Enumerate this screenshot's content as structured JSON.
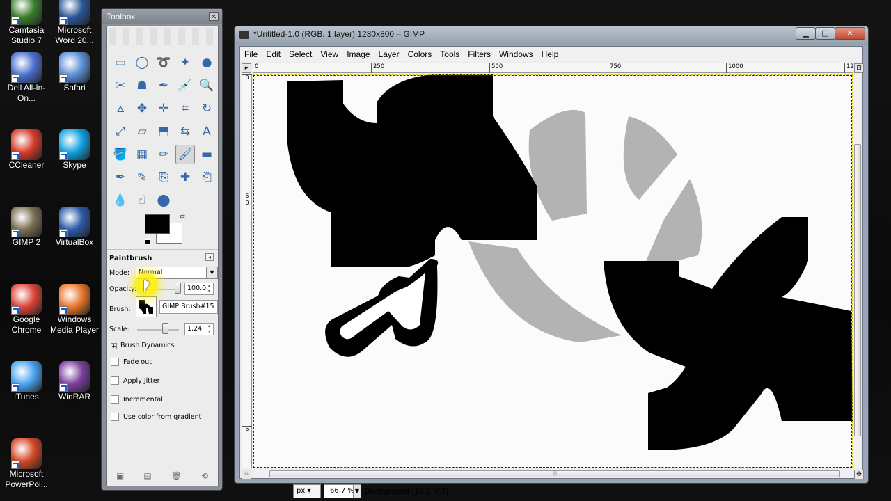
{
  "desktop": {
    "icons": [
      {
        "label": "Camtasia Studio 7",
        "icon": "camtasia-icon",
        "color": "#3a7d2c"
      },
      {
        "label": "Microsoft Word 20...",
        "icon": "word-icon",
        "color": "#2b5797"
      },
      {
        "label": "Dell All-In-On...",
        "icon": "dell-icon",
        "color": "#4a6fd0"
      },
      {
        "label": "Safari",
        "icon": "safari-icon",
        "color": "#5b8fd6"
      },
      {
        "label": "CCleaner",
        "icon": "ccleaner-icon",
        "color": "#d43a2a"
      },
      {
        "label": "Skype",
        "icon": "skype-icon",
        "color": "#10a2e0"
      },
      {
        "label": "GIMP 2",
        "icon": "gimp-icon",
        "color": "#7a6d55"
      },
      {
        "label": "VirtualBox",
        "icon": "virtualbox-icon",
        "color": "#2a5aa8"
      },
      {
        "label": "Google Chrome",
        "icon": "chrome-icon",
        "color": "#db4437"
      },
      {
        "label": "Windows Media Player",
        "icon": "media-player-icon",
        "color": "#e8762c"
      },
      {
        "label": "iTunes",
        "icon": "itunes-icon",
        "color": "#4aa3f0"
      },
      {
        "label": "WinRAR",
        "icon": "winrar-icon",
        "color": "#7b3f9e"
      },
      {
        "label": "Microsoft PowerPoi...",
        "icon": "powerpoint-icon",
        "color": "#d24726"
      }
    ]
  },
  "toolbox": {
    "title": "Toolbox",
    "close": "×",
    "tools": [
      "rect-select-icon",
      "ellipse-select-icon",
      "free-select-icon",
      "fuzzy-select-icon",
      "color-select-icon",
      "scissors-icon",
      "foreground-select-icon",
      "paths-icon",
      "color-picker-icon",
      "zoom-icon",
      "measure-icon",
      "move-icon",
      "align-icon",
      "crop-icon",
      "rotate-icon",
      "scale-icon",
      "shear-icon",
      "perspective-icon",
      "flip-icon",
      "text-icon",
      "bucket-fill-icon",
      "blend-icon",
      "pencil-icon",
      "paintbrush-icon",
      "eraser-icon",
      "airbrush-icon",
      "ink-icon",
      "clone-icon",
      "heal-icon",
      "perspective-clone-icon",
      "blur-icon",
      "smudge-icon",
      "dodge-burn-icon"
    ],
    "tool_glyphs": [
      "▭",
      "◯",
      "➰",
      "✦",
      "●",
      "✂",
      "☗",
      "✒",
      "💉",
      "🔍",
      "⩟",
      "✥",
      "✛",
      "⌗",
      "↻",
      "⤢",
      "▱",
      "⬒",
      "⇆",
      "A",
      "🪣",
      "▦",
      "✏",
      "🖌",
      "▬",
      "✒",
      "✎",
      "⎘",
      "✚",
      "⎗",
      "💧",
      "☝",
      "⬤"
    ],
    "selected_tool": "paintbrush-icon",
    "options": {
      "title": "Paintbrush",
      "mode_label": "Mode:",
      "mode_value": "Normal",
      "opacity_label": "Opacity:",
      "opacity_value": "100.0",
      "brush_label": "Brush:",
      "brush_name": "GIMP Brush#15",
      "scale_label": "Scale:",
      "scale_value": "1.24",
      "brush_dynamics": "Brush Dynamics",
      "checkboxes": [
        "Fade out",
        "Apply Jitter",
        "Incremental",
        "Use color from gradient"
      ]
    },
    "colors": {
      "foreground": "#000000",
      "background": "#ffffff"
    }
  },
  "image_window": {
    "title": "*Untitled-1.0 (RGB, 1 layer) 1280x800 – GIMP",
    "buttons": {
      "minimize": "▁",
      "maximize": "□",
      "close": "✕"
    },
    "menu": [
      "File",
      "Edit",
      "Select",
      "View",
      "Image",
      "Layer",
      "Colors",
      "Tools",
      "Filters",
      "Windows",
      "Help"
    ],
    "ruler_h": [
      "0",
      "250",
      "500",
      "750",
      "1000",
      "125"
    ],
    "ruler_v": [
      "0",
      "",
      "5",
      "0",
      "",
      "5"
    ],
    "status": {
      "unit": "px",
      "zoom": "66.7 %",
      "layer_info": "Background (12.2 MB)"
    }
  }
}
